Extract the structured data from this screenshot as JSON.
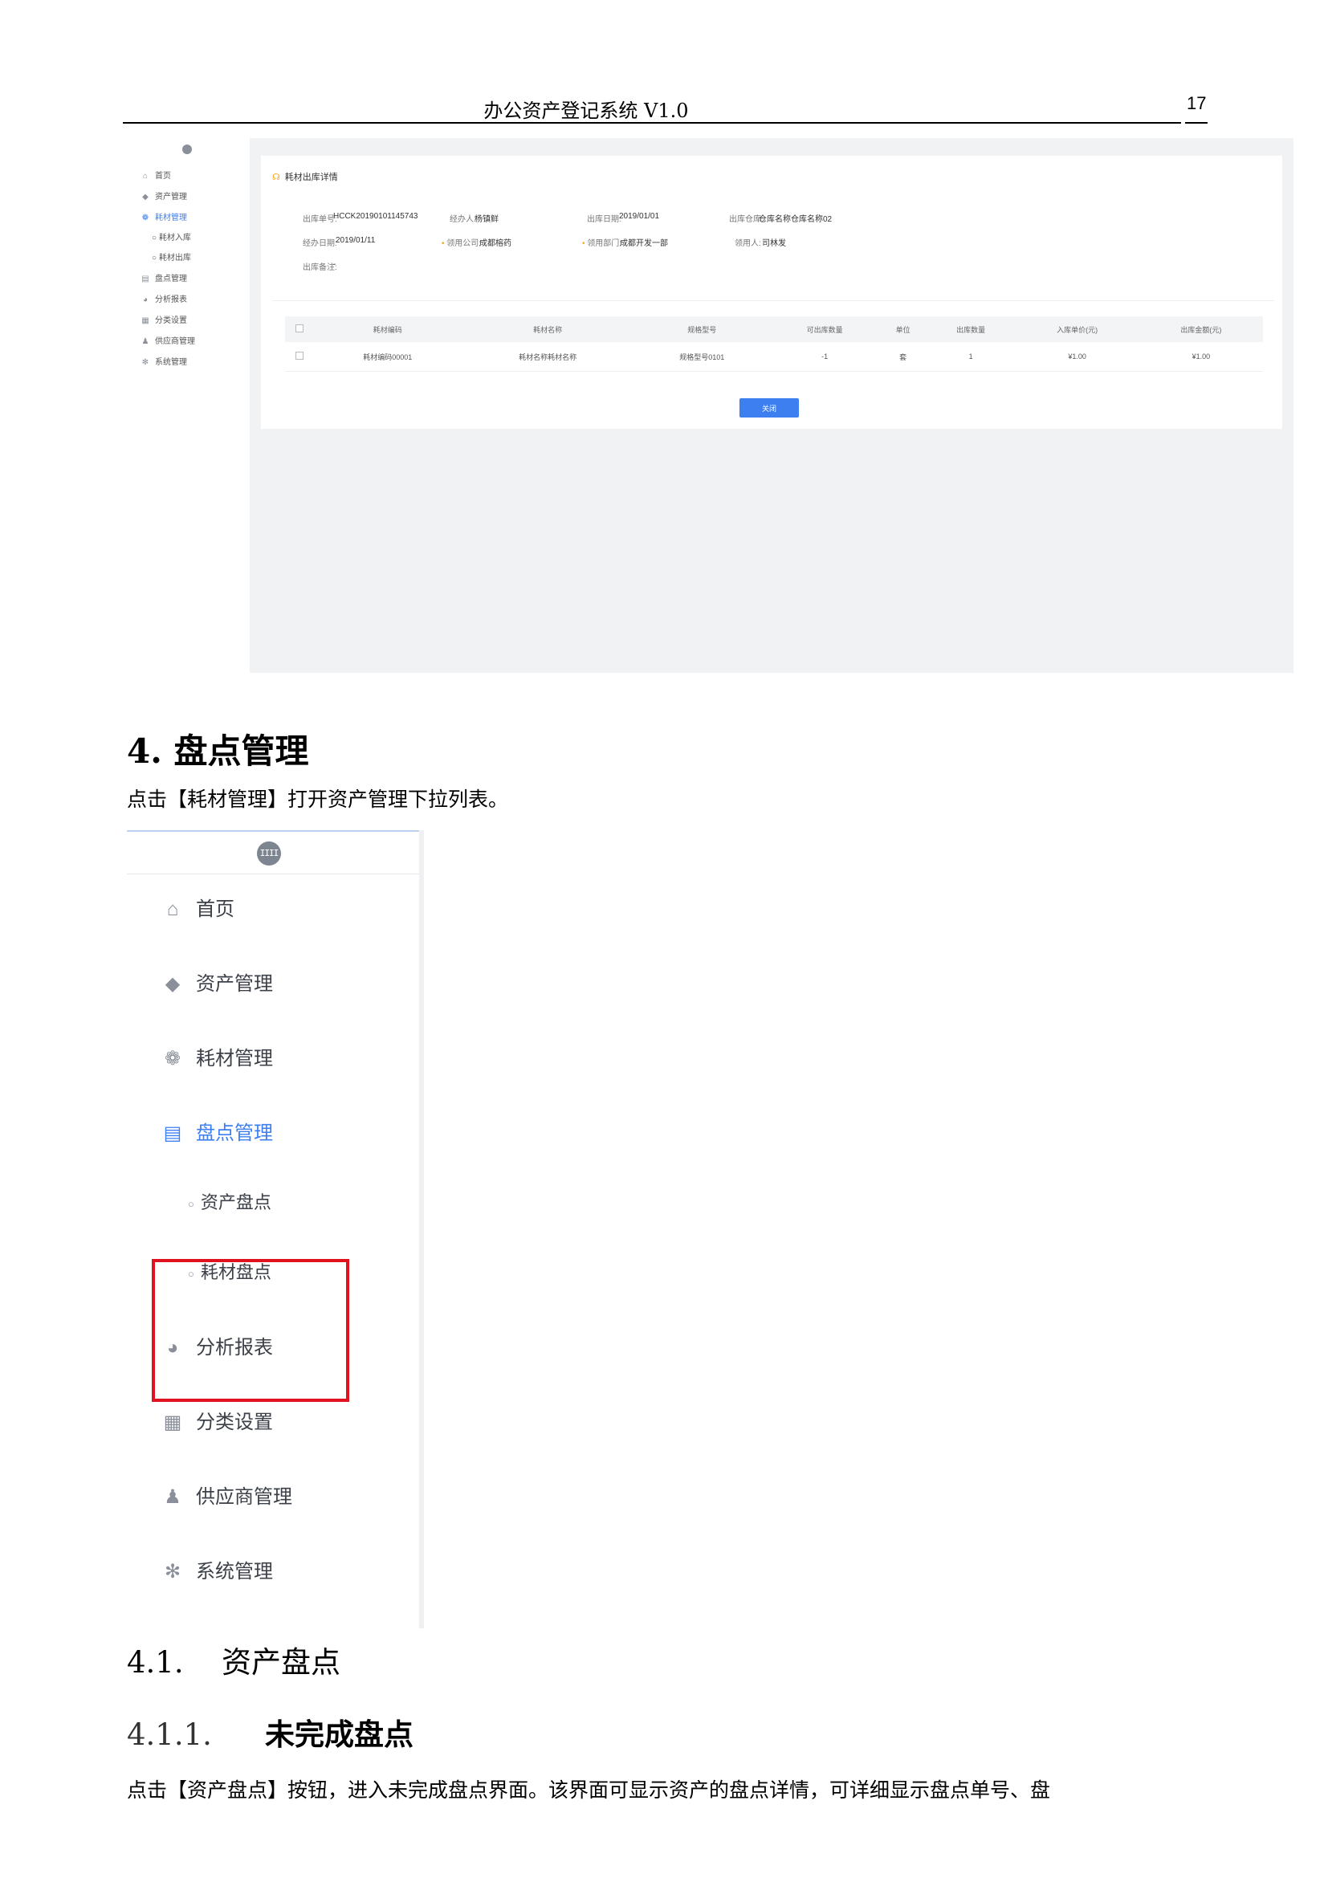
{
  "header": {
    "title": "办公资产登记系统 V1.0",
    "page_number": "17"
  },
  "screenshot1": {
    "sidebar": {
      "items": [
        {
          "label": "首页",
          "icon": "home-icon"
        },
        {
          "label": "资产管理",
          "icon": "cube-icon"
        },
        {
          "label": "耗材管理",
          "icon": "consumables-icon"
        },
        {
          "label": "盘点管理",
          "icon": "calendar-icon"
        },
        {
          "label": "分析报表",
          "icon": "pie-chart-icon"
        },
        {
          "label": "分类设置",
          "icon": "grid-icon"
        },
        {
          "label": "供应商管理",
          "icon": "user-icon"
        },
        {
          "label": "系统管理",
          "icon": "gear-icon"
        }
      ],
      "subitems": [
        "耗材入库",
        "耗材出库"
      ]
    },
    "card_title": "耗材出库详情",
    "fields": {
      "out_no_label": "出库单号:",
      "out_no": "HCCK20190101145743",
      "handler_label": "经办人:",
      "handler": "杨镇鲜",
      "out_date_label": "出库日期:",
      "out_date": "2019/01/01",
      "warehouse_label": "出库仓库:",
      "warehouse": "仓库名称仓库名称02",
      "handle_date_label": "经办日期:",
      "handle_date": "2019/01/11",
      "company_label": "领用公司:",
      "company": "成都榕药",
      "dept_label": "领用部门:",
      "dept": "成都开发一部",
      "recipient_label": "领用人:",
      "recipient": "司林发",
      "remark_label": "出库备注:",
      "remark": "-"
    },
    "table": {
      "headers": [
        "耗材编码",
        "耗材名称",
        "规格型号",
        "可出库数量",
        "单位",
        "出库数量",
        "入库单价(元)",
        "出库金额(元)"
      ],
      "rows": [
        [
          "耗材编码00001",
          "耗材名称耗材名称",
          "规格型号0101",
          "-1",
          "套",
          "1",
          "¥1.00",
          "¥1.00"
        ]
      ]
    },
    "close_button": "关闭"
  },
  "section4": {
    "heading_num": "4.",
    "heading_text": "盘点管理",
    "intro": "点击【耗材管理】打开资产管理下拉列表。"
  },
  "screenshot2": {
    "logo_text": "IIII",
    "items": {
      "home": "首页",
      "assets": "资产管理",
      "consumables": "耗材管理",
      "inventory": "盘点管理",
      "sub_asset_inventory": "资产盘点",
      "sub_consumable_inventory": "耗材盘点",
      "reports": "分析报表",
      "categories": "分类设置",
      "suppliers": "供应商管理",
      "system": "系统管理"
    }
  },
  "section41": {
    "num": "4.1.",
    "text": "资产盘点"
  },
  "section411": {
    "num": "4.1.1.",
    "text": "未完成盘点"
  },
  "body_text": "点击【资产盘点】按钮，进入未完成盘点界面。该界面可显示资产的盘点详情，可详细显示盘点单号、盘",
  "colors": {
    "accent": "#3d7ff0",
    "highlight_box": "#e0121d",
    "warning": "#f5a623"
  }
}
